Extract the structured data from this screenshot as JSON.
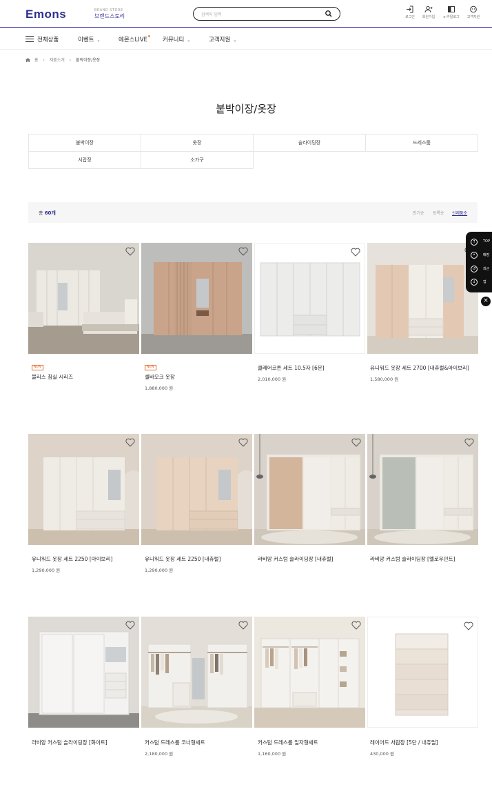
{
  "header": {
    "logo": "Emons",
    "brand_small": "BRAND STORE",
    "brand_label": "브랜드스토리",
    "search_placeholder": "검색어 입력",
    "utils": [
      {
        "label": "로그인",
        "icon": "login-icon"
      },
      {
        "label": "회원가입",
        "icon": "signup-icon"
      },
      {
        "label": "e-카탈로그",
        "icon": "catalog-icon"
      },
      {
        "label": "고객지원",
        "icon": "support-icon"
      }
    ]
  },
  "nav": {
    "all_products": "전체상품",
    "items": [
      {
        "label": "이벤트",
        "has_dropdown": true
      },
      {
        "label": "에몬스LIVE",
        "has_dropdown": false
      },
      {
        "label": "커뮤니티",
        "has_dropdown": true
      },
      {
        "label": "고객지원",
        "has_dropdown": true
      }
    ]
  },
  "breadcrumb": {
    "items": [
      "홈",
      "제품소개",
      "붙박이장/옷장"
    ]
  },
  "page_title": "붙박이장/옷장",
  "categories": [
    "붙박이장",
    "옷장",
    "슬라이딩장",
    "드레스룸",
    "서랍장",
    "소가구"
  ],
  "toolbar": {
    "total_prefix": "총",
    "total_count": "60개",
    "sort_options": [
      "인기순",
      "등록순",
      "신제품순"
    ],
    "active_sort": "신제품순"
  },
  "products": [
    {
      "name": "블리스 침실 시리즈",
      "price": "",
      "badge": "NEW",
      "image": "bedroom-wardrobe"
    },
    {
      "name": "셀바오크 옷장",
      "price": "1,880,000 원",
      "badge": "NEW",
      "image": "oak-wardrobe"
    },
    {
      "name": "클레어코튼 세트 10.5자 [6문]",
      "price": "2,010,000 원",
      "badge": "",
      "image": "white-wardrobe"
    },
    {
      "name": "유니워드 옷장 세트 2700 [내츄럴&아이보리]",
      "price": "1,580,000 원",
      "badge": "",
      "image": "natural-ivory-wardrobe"
    },
    {
      "name": "유니워드 옷장 세트 2250 [아이보리]",
      "price": "1,290,000 원",
      "badge": "",
      "image": "ivory-wardrobe"
    },
    {
      "name": "유니워드 옷장 세트 2250 [내츄럴]",
      "price": "1,290,000 원",
      "badge": "",
      "image": "natural-wardrobe"
    },
    {
      "name": "라비앙 커스텀 슬라이딩장 [내츄럴]",
      "price": "",
      "badge": "",
      "image": "sliding-natural"
    },
    {
      "name": "라비앙 커스텀 슬라이딩장 [멜로우민트]",
      "price": "",
      "badge": "",
      "image": "sliding-mint"
    },
    {
      "name": "라비앙 커스텀 슬라이딩장 [화이트]",
      "price": "",
      "badge": "",
      "image": "sliding-white"
    },
    {
      "name": "커스텀 드레스룸 코너형세트",
      "price": "2,180,000 원",
      "badge": "",
      "image": "dressroom-corner"
    },
    {
      "name": "커스텀 드레스룸 일자형세트",
      "price": "1,160,000 원",
      "badge": "",
      "image": "dressroom-straight"
    },
    {
      "name": "레이어드 서랍장 [5단 / 내츄럴]",
      "price": "430,000 원",
      "badge": "",
      "image": "drawer-chest"
    }
  ],
  "side_panel": [
    "TOP",
    "매장",
    "최근",
    "앱"
  ]
}
